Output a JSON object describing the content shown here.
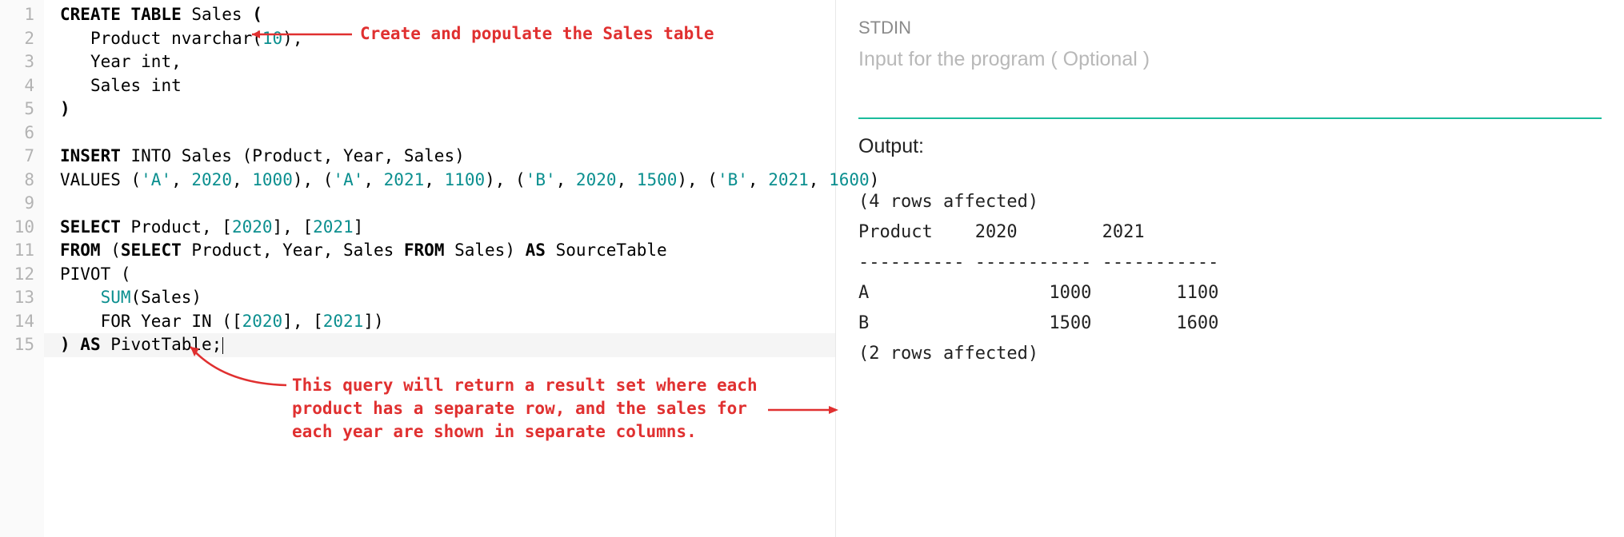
{
  "editor": {
    "line_numbers": [
      "1",
      "2",
      "3",
      "4",
      "5",
      "6",
      "7",
      "8",
      "9",
      "10",
      "11",
      "12",
      "13",
      "14",
      "15"
    ],
    "lines": {
      "l1": {
        "kw1": "CREATE TABLE",
        "t1": " Sales ",
        "p1": "("
      },
      "l2": {
        "indent": "   ",
        "t1": "Product nvarchar(",
        "n1": "10",
        "t2": "),"
      },
      "l3": {
        "indent": "   ",
        "t1": "Year int,"
      },
      "l4": {
        "indent": "   ",
        "t1": "Sales int"
      },
      "l5": {
        "t1": ")"
      },
      "l6": {
        "t1": ""
      },
      "l7": {
        "kw1": "INSERT",
        "t1": " INTO Sales (Product, Year, Sales)"
      },
      "l8": {
        "t1": "VALUES (",
        "s1": "'A'",
        "c1": ", ",
        "n1": "2020",
        "c2": ", ",
        "n2": "1000",
        "t2": "), (",
        "s2": "'A'",
        "c3": ", ",
        "n3": "2021",
        "c4": ", ",
        "n4": "1100",
        "t3": "), (",
        "s3": "'B'",
        "c5": ", ",
        "n5": "2020",
        "c6": ", ",
        "n6": "1500",
        "t4": "), (",
        "s4": "'B'",
        "c7": ", ",
        "n7": "2021",
        "c8": ", ",
        "n8": "1600",
        "t5": ")"
      },
      "l9": {
        "t1": ""
      },
      "l10": {
        "kw1": "SELECT",
        "t1": " Product, [",
        "n1": "2020",
        "t2": "], [",
        "n2": "2021",
        "t3": "]"
      },
      "l11": {
        "kw1": "FROM",
        "t1": " (",
        "kw2": "SELECT",
        "t2": " Product, Year, Sales ",
        "kw3": "FROM",
        "t3": " Sales) ",
        "kw4": "AS",
        "t4": " SourceTable"
      },
      "l12": {
        "t1": "PIVOT ("
      },
      "l13": {
        "indent": "    ",
        "fn1": "SUM",
        "t1": "(Sales)"
      },
      "l14": {
        "indent": "    ",
        "t1": "FOR Year IN ([",
        "n1": "2020",
        "t2": "], [",
        "n2": "2021",
        "t3": "])"
      },
      "l15": {
        "t1": ") ",
        "kw1": "AS",
        "t2": " PivotTable;"
      }
    }
  },
  "annotations": {
    "a1_l1": "Create and populate the Sales table",
    "a2_l1": "This query will return a result set where each",
    "a2_l2": "product has a separate row, and the sales for",
    "a2_l3": "each year are shown in separate columns."
  },
  "stdin": {
    "label": "STDIN",
    "placeholder": "Input for the program ( Optional )"
  },
  "output": {
    "label": "Output:",
    "lines": [
      "",
      "(4 rows affected)",
      "Product    2020        2021       ",
      "---------- ----------- -----------",
      "A                 1000        1100",
      "B                 1500        1600",
      "",
      "(2 rows affected)"
    ]
  },
  "colors": {
    "annot": "#e03030",
    "accent": "#1abc9c",
    "num": "#0b8f8f"
  }
}
